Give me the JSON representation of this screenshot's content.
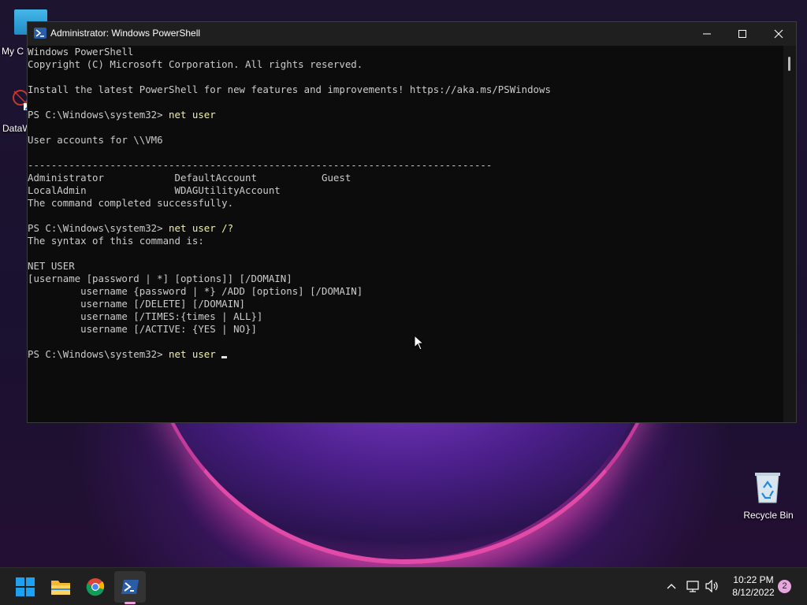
{
  "desktop": {
    "icons": [
      {
        "label": "My C"
      },
      {
        "label": "DataW"
      },
      {
        "label": "Recycle Bin"
      }
    ]
  },
  "window": {
    "title": "Administrator: Windows PowerShell"
  },
  "console": {
    "lines": [
      {
        "prompt": "",
        "text": "Windows PowerShell"
      },
      {
        "prompt": "",
        "text": "Copyright (C) Microsoft Corporation. All rights reserved."
      },
      {
        "prompt": "",
        "text": ""
      },
      {
        "prompt": "",
        "text": "Install the latest PowerShell for new features and improvements! https://aka.ms/PSWindows"
      },
      {
        "prompt": "",
        "text": ""
      },
      {
        "prompt": "PS C:\\Windows\\system32> ",
        "text": "net user"
      },
      {
        "prompt": "",
        "text": ""
      },
      {
        "prompt": "",
        "text": "User accounts for \\\\VM6"
      },
      {
        "prompt": "",
        "text": ""
      },
      {
        "prompt": "",
        "text": "-------------------------------------------------------------------------------"
      },
      {
        "prompt": "",
        "text": "Administrator            DefaultAccount           Guest"
      },
      {
        "prompt": "",
        "text": "LocalAdmin               WDAGUtilityAccount"
      },
      {
        "prompt": "",
        "text": "The command completed successfully."
      },
      {
        "prompt": "",
        "text": ""
      },
      {
        "prompt": "PS C:\\Windows\\system32> ",
        "text": "net user /?"
      },
      {
        "prompt": "",
        "text": "The syntax of this command is:"
      },
      {
        "prompt": "",
        "text": ""
      },
      {
        "prompt": "",
        "text": "NET USER"
      },
      {
        "prompt": "",
        "text": "[username [password | *] [options]] [/DOMAIN]"
      },
      {
        "prompt": "",
        "text": "         username {password | *} /ADD [options] [/DOMAIN]"
      },
      {
        "prompt": "",
        "text": "         username [/DELETE] [/DOMAIN]"
      },
      {
        "prompt": "",
        "text": "         username [/TIMES:{times | ALL}]"
      },
      {
        "prompt": "",
        "text": "         username [/ACTIVE: {YES | NO}]"
      },
      {
        "prompt": "",
        "text": ""
      },
      {
        "prompt": "PS C:\\Windows\\system32> ",
        "text": "net user "
      }
    ]
  },
  "taskbar": {
    "apps": [
      {
        "name": "start-icon"
      },
      {
        "name": "file-explorer-icon"
      },
      {
        "name": "chrome-icon"
      },
      {
        "name": "powershell-icon"
      }
    ],
    "tray": {
      "time": "10:22 PM",
      "date": "8/12/2022",
      "notifications": "2"
    }
  }
}
